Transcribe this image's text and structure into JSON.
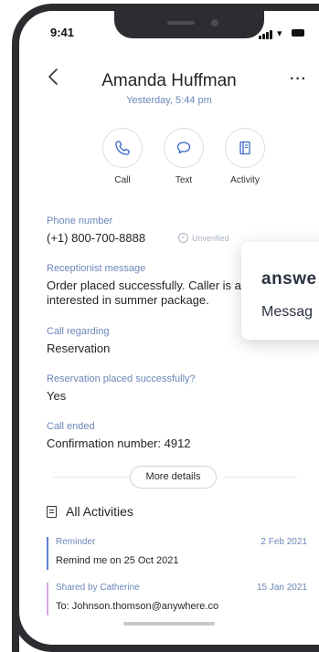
{
  "status_bar": {
    "time": "9:41"
  },
  "header": {
    "name": "Amanda Huffman",
    "subtitle": "Yesterday, 5:44 pm"
  },
  "actions": [
    {
      "label": "Call",
      "icon": "phone-icon"
    },
    {
      "label": "Text",
      "icon": "chat-bubble-icon"
    },
    {
      "label": "Activity",
      "icon": "notebook-icon"
    }
  ],
  "fields": {
    "phone": {
      "label": "Phone number",
      "value": "(+1) 800-700-8888",
      "badge": "Unverified"
    },
    "receptionist": {
      "label": "Receptionist message",
      "line1": "Order placed successfully. Caller is a",
      "line2": "interested in summer package."
    },
    "regarding": {
      "label": "Call regarding",
      "value": "Reservation"
    },
    "reservation": {
      "label": "Reservation placed successfully?",
      "value": "Yes"
    },
    "ended": {
      "label": "Call ended",
      "value": "Confirmation number: 4912"
    }
  },
  "more_details_label": "More details",
  "activities": {
    "title": "All Activities",
    "items": [
      {
        "type": "Reminder",
        "date": "2 Feb 2021",
        "text": "Remind me on 25 Oct 2021",
        "color": "#5b7fd1"
      },
      {
        "type": "Shared by Catherine",
        "date": "15 Jan 2021",
        "text": "To: Johnson.thomson@anywhere.co",
        "color": "#d9a6e6"
      }
    ]
  },
  "popup": {
    "title": "answe",
    "message": "Messag"
  }
}
